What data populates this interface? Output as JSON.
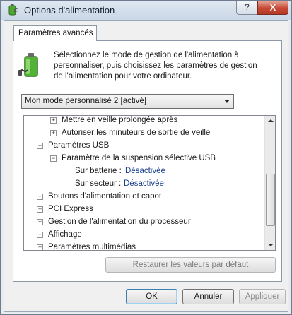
{
  "window": {
    "title": "Options d'alimentation",
    "help_label": "?",
    "close_label": "X",
    "icon": "power-options-icon"
  },
  "tab": {
    "label": "Paramètres avancés"
  },
  "intro": {
    "text": "Sélectionnez le mode de gestion de l'alimentation à personnaliser, puis choisissez les paramètres de gestion de l'alimentation pour votre ordinateur.",
    "icon": "battery-plug-icon"
  },
  "plan_select": {
    "selected": "Mon mode personnalisé 2 [activé]"
  },
  "tree": {
    "rows": [
      {
        "id": "hibernate",
        "expander": "+",
        "label": "Mettre en veille prolongée après"
      },
      {
        "id": "wake-timers",
        "expander": "+",
        "label": "Autoriser les minuteurs de sortie de veille"
      },
      {
        "id": "usb",
        "expander": "−",
        "label": "Paramètres USB"
      },
      {
        "id": "usb-suspend",
        "expander": "−",
        "label": "Paramètre de la suspension sélective USB"
      },
      {
        "id": "on-battery",
        "label": "Sur batterie :",
        "value": "Désactivée"
      },
      {
        "id": "plugged-in",
        "label": "Sur secteur :",
        "value": "Désactivée"
      },
      {
        "id": "power-buttons",
        "expander": "+",
        "label": "Boutons d'alimentation et capot"
      },
      {
        "id": "pci-express",
        "expander": "+",
        "label": "PCI Express"
      },
      {
        "id": "processor",
        "expander": "+",
        "label": "Gestion de l'alimentation du processeur"
      },
      {
        "id": "display",
        "expander": "+",
        "label": "Affichage"
      },
      {
        "id": "multimedia",
        "expander": "+",
        "label": "Paramètres multimédias"
      }
    ]
  },
  "buttons": {
    "restore": "Restaurer les valeurs par défaut",
    "ok": "OK",
    "cancel": "Annuler",
    "apply": "Appliquer"
  },
  "colors": {
    "value_text": "#1a3f8f",
    "close_button": "#c74a35"
  }
}
